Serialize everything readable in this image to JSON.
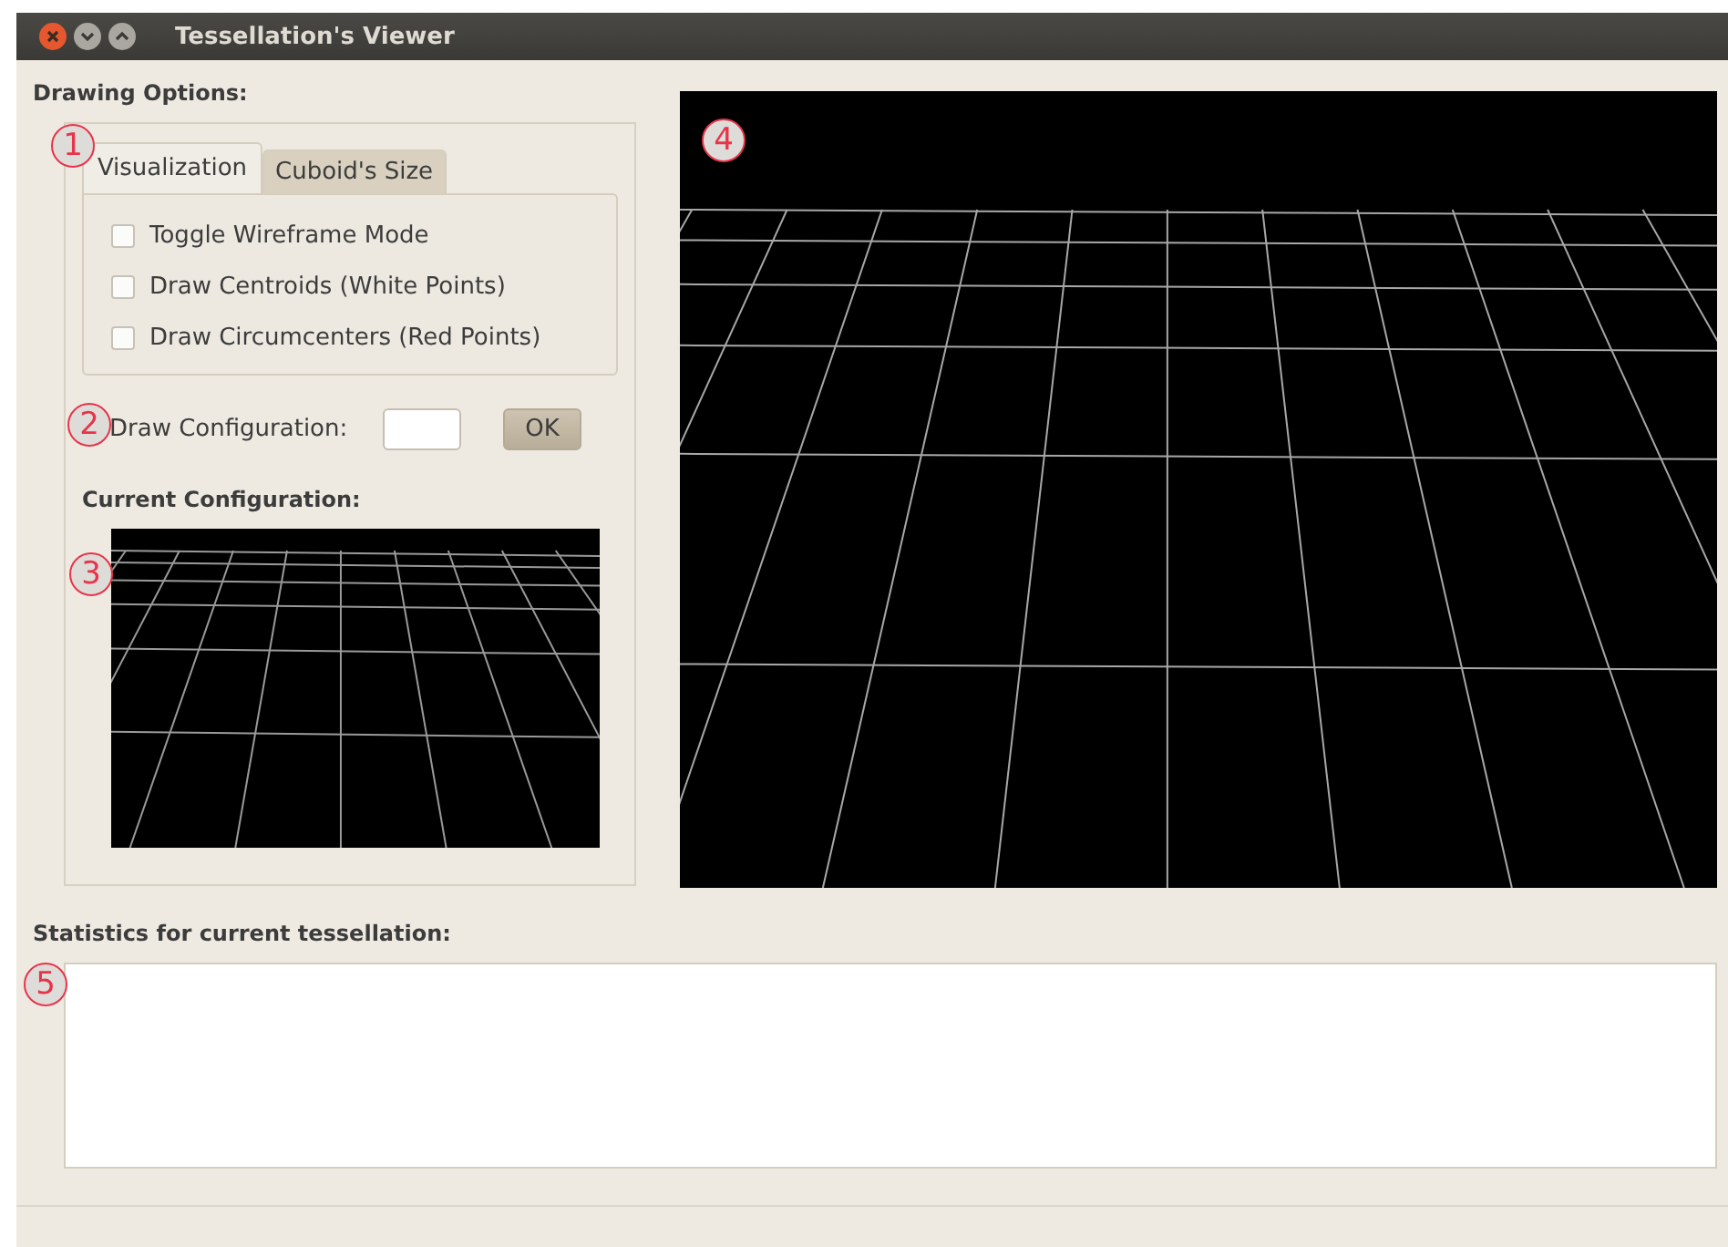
{
  "window": {
    "title": "Tessellation's Viewer"
  },
  "drawing_options": {
    "label": "Drawing Options:",
    "callout": "1",
    "tabs": [
      {
        "label": "Visualization",
        "selected": true
      },
      {
        "label": "Cuboid's Size",
        "selected": false
      }
    ],
    "checkboxes": [
      {
        "label": "Toggle Wireframe Mode",
        "checked": false
      },
      {
        "label": "Draw Centroids (White Points)",
        "checked": false
      },
      {
        "label": "Draw Circumcenters (Red Points)",
        "checked": false
      }
    ],
    "draw_configuration": {
      "callout": "2",
      "label": "Draw Configuration:",
      "button": "OK"
    },
    "current_configuration": {
      "callout": "3",
      "label": "Current Configuration:"
    }
  },
  "main_view": {
    "callout": "4"
  },
  "statistics": {
    "label": "Statistics for current tessellation:",
    "callout": "5"
  }
}
